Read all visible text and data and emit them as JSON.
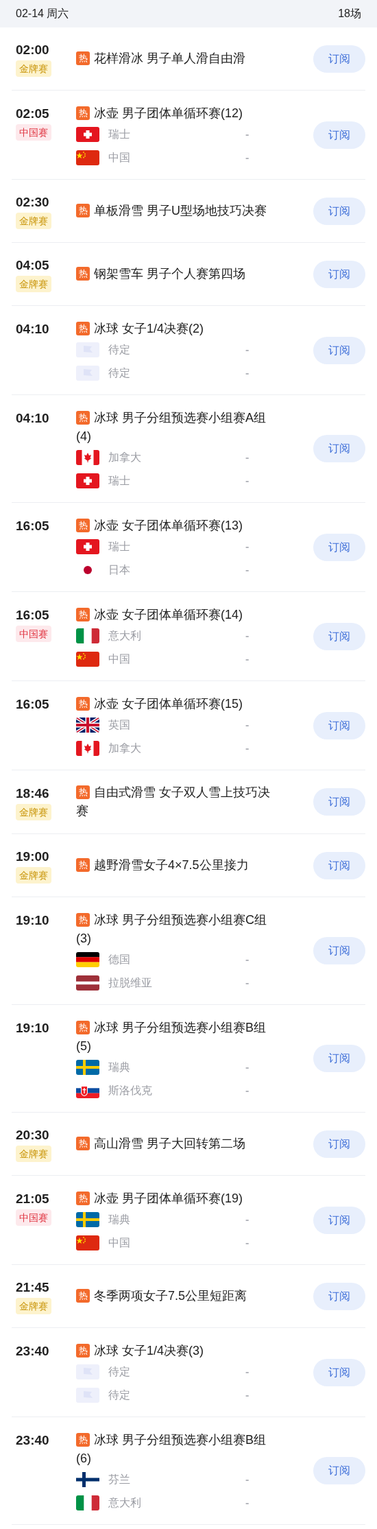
{
  "header": {
    "date": "02-14 周六",
    "count": "18场"
  },
  "events": [
    {
      "time": "02:00",
      "tag": {
        "kind": "gold",
        "text": "金牌赛"
      },
      "hot": "热",
      "title": "花样滑冰 男子单人滑自由滑",
      "button": "订阅"
    },
    {
      "time": "02:05",
      "tag": {
        "kind": "china",
        "text": "中国赛"
      },
      "hot": "热",
      "title": "冰壶 男子团体单循环赛(12)",
      "teams": [
        {
          "kind": "ch",
          "name": "瑞士",
          "score": "-"
        },
        {
          "kind": "cn",
          "name": "中国",
          "score": "-"
        }
      ],
      "button": "订阅"
    },
    {
      "time": "02:30",
      "tag": {
        "kind": "gold",
        "text": "金牌赛"
      },
      "hot": "热",
      "title": "单板滑雪 男子U型场地技巧决赛",
      "button": "订阅"
    },
    {
      "time": "04:05",
      "tag": {
        "kind": "gold",
        "text": "金牌赛"
      },
      "hot": "热",
      "title": "钢架雪车 男子个人赛第四场",
      "button": "订阅"
    },
    {
      "time": "04:10",
      "hot": "热",
      "title": "冰球 女子1/4决赛(2)",
      "teams": [
        {
          "kind": "tbd",
          "name": "待定",
          "score": "-"
        },
        {
          "kind": "tbd",
          "name": "待定",
          "score": "-"
        }
      ],
      "button": "订阅"
    },
    {
      "time": "04:10",
      "hot": "热",
      "title": "冰球 男子分组预选赛小组赛A组(4)",
      "teams": [
        {
          "kind": "ca",
          "name": "加拿大",
          "score": "-"
        },
        {
          "kind": "ch",
          "name": "瑞士",
          "score": "-"
        }
      ],
      "button": "订阅"
    },
    {
      "time": "16:05",
      "hot": "热",
      "title": "冰壶 女子团体单循环赛(13)",
      "teams": [
        {
          "kind": "ch",
          "name": "瑞士",
          "score": "-"
        },
        {
          "kind": "jp",
          "name": "日本",
          "score": "-"
        }
      ],
      "button": "订阅"
    },
    {
      "time": "16:05",
      "tag": {
        "kind": "china",
        "text": "中国赛"
      },
      "hot": "热",
      "title": "冰壶 女子团体单循环赛(14)",
      "teams": [
        {
          "kind": "it",
          "name": "意大利",
          "score": "-"
        },
        {
          "kind": "cn",
          "name": "中国",
          "score": "-"
        }
      ],
      "button": "订阅"
    },
    {
      "time": "16:05",
      "hot": "热",
      "title": "冰壶 女子团体单循环赛(15)",
      "teams": [
        {
          "kind": "gb",
          "name": "英国",
          "score": "-"
        },
        {
          "kind": "ca",
          "name": "加拿大",
          "score": "-"
        }
      ],
      "button": "订阅"
    },
    {
      "time": "18:46",
      "tag": {
        "kind": "gold",
        "text": "金牌赛"
      },
      "hot": "热",
      "title": "自由式滑雪 女子双人雪上技巧决赛",
      "button": "订阅"
    },
    {
      "time": "19:00",
      "tag": {
        "kind": "gold",
        "text": "金牌赛"
      },
      "hot": "热",
      "title": "越野滑雪女子4×7.5公里接力",
      "button": "订阅"
    },
    {
      "time": "19:10",
      "hot": "热",
      "title": "冰球 男子分组预选赛小组赛C组(3)",
      "teams": [
        {
          "kind": "de",
          "name": "德国",
          "score": "-"
        },
        {
          "kind": "lv",
          "name": "拉脱维亚",
          "score": "-"
        }
      ],
      "button": "订阅"
    },
    {
      "time": "19:10",
      "hot": "热",
      "title": "冰球 男子分组预选赛小组赛B组(5)",
      "teams": [
        {
          "kind": "se",
          "name": "瑞典",
          "score": "-"
        },
        {
          "kind": "sk",
          "name": "斯洛伐克",
          "score": "-"
        }
      ],
      "button": "订阅"
    },
    {
      "time": "20:30",
      "tag": {
        "kind": "gold",
        "text": "金牌赛"
      },
      "hot": "热",
      "title": "高山滑雪 男子大回转第二场",
      "button": "订阅"
    },
    {
      "time": "21:05",
      "tag": {
        "kind": "china",
        "text": "中国赛"
      },
      "hot": "热",
      "title": "冰壶 男子团体单循环赛(19)",
      "teams": [
        {
          "kind": "se",
          "name": "瑞典",
          "score": "-"
        },
        {
          "kind": "cn",
          "name": "中国",
          "score": "-"
        }
      ],
      "button": "订阅"
    },
    {
      "time": "21:45",
      "tag": {
        "kind": "gold",
        "text": "金牌赛"
      },
      "hot": "热",
      "title": "冬季两项女子7.5公里短距离",
      "button": "订阅"
    },
    {
      "time": "23:40",
      "hot": "热",
      "title": "冰球 女子1/4决赛(3)",
      "teams": [
        {
          "kind": "tbd",
          "name": "待定",
          "score": "-"
        },
        {
          "kind": "tbd",
          "name": "待定",
          "score": "-"
        }
      ],
      "button": "订阅"
    },
    {
      "time": "23:40",
      "hot": "热",
      "title": "冰球 男子分组预选赛小组赛B组(6)",
      "teams": [
        {
          "kind": "fi",
          "name": "芬兰",
          "score": "-"
        },
        {
          "kind": "it",
          "name": "意大利",
          "score": "-"
        }
      ],
      "button": "订阅"
    }
  ]
}
